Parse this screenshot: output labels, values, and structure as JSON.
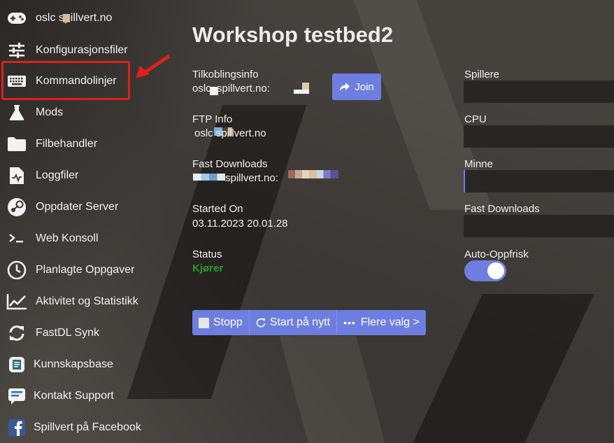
{
  "sidebar": {
    "items": [
      {
        "label": "oslc   spillvert.no",
        "icon": "gamepad-icon"
      },
      {
        "label": "Konfigurasjonsfiler",
        "icon": "sliders-icon"
      },
      {
        "label": "Kommandolinjer",
        "icon": "keyboard-icon"
      },
      {
        "label": "Mods",
        "icon": "flask-icon"
      },
      {
        "label": "Filbehandler",
        "icon": "folder-icon"
      },
      {
        "label": "Loggfiler",
        "icon": "log-file-icon"
      },
      {
        "label": "Oppdater Server",
        "icon": "steam-icon"
      },
      {
        "label": "Web Konsoll",
        "icon": "terminal-icon"
      },
      {
        "label": "Planlagte Oppgaver",
        "icon": "clock-icon"
      },
      {
        "label": "Aktivitet og Statistikk",
        "icon": "chart-line-icon"
      },
      {
        "label": "FastDL Synk",
        "icon": "sync-icon"
      },
      {
        "label": "Kunnskapsbase",
        "icon": "book-icon"
      },
      {
        "label": "Kontakt Support",
        "icon": "chat-icon"
      },
      {
        "label": "Spillvert på Facebook",
        "icon": "facebook-icon"
      }
    ],
    "active_index": 2
  },
  "main": {
    "title": "Workshop testbed2",
    "connection": {
      "label": "Tilkoblingsinfo",
      "value": "oslc  .spillvert.no:"
    },
    "join_label": "Join",
    "ftp": {
      "label": "FTP Info",
      "value": "oslc   spillvert.no"
    },
    "fastdl": {
      "label": "Fast Downloads",
      "value": "spillvert.no:"
    },
    "started": {
      "label": "Started On",
      "value": "03.11.2023 20.01.28"
    },
    "status": {
      "label": "Status",
      "value": "Kjører"
    },
    "actions": [
      {
        "label": "Stopp",
        "icon": "stop-icon"
      },
      {
        "label": "Start på nytt",
        "icon": "restart-icon"
      },
      {
        "label": "Flere valg >",
        "icon": "more-icon"
      }
    ]
  },
  "right": {
    "players_label": "Spillere",
    "cpu_label": "CPU",
    "memory_label": "Minne",
    "fastdl_label": "Fast Downloads",
    "autorefresh_label": "Auto-Oppfrisk",
    "autorefresh_on": true
  },
  "colors": {
    "accent": "#6d7ee0",
    "status_running": "#2e9a2a",
    "highlight": "#e0201b"
  }
}
